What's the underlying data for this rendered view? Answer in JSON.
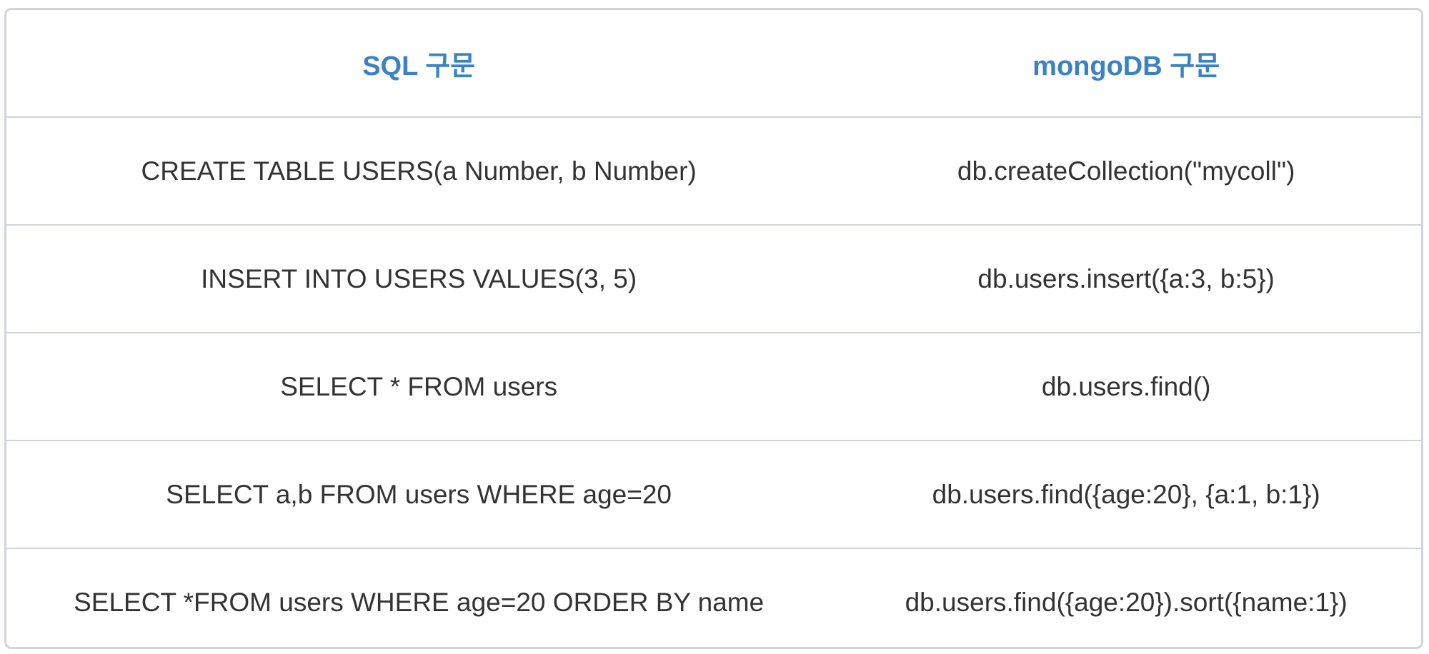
{
  "table": {
    "headers": [
      "SQL 구문",
      "mongoDB 구문"
    ],
    "rows": [
      [
        "CREATE TABLE USERS(a Number, b Number)",
        "db.createCollection(\"mycoll\")"
      ],
      [
        "INSERT INTO USERS VALUES(3, 5)",
        "db.users.insert({a:3, b:5})"
      ],
      [
        "SELECT * FROM users",
        "db.users.find()"
      ],
      [
        "SELECT a,b FROM users WHERE age=20",
        "db.users.find({age:20}, {a:1, b:1})"
      ],
      [
        "SELECT *FROM users WHERE age=20 ORDER BY name",
        "db.users.find({age:20}).sort({name:1})"
      ]
    ]
  },
  "colors": {
    "header_text": "#3a82c4",
    "body_text": "#333333",
    "border": "#d2d4dc"
  }
}
